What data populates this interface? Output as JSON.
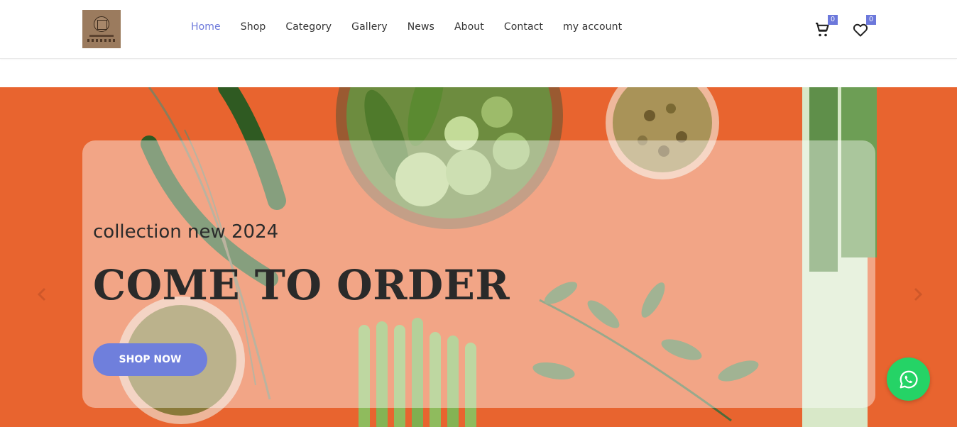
{
  "header": {
    "logo_name": "logo",
    "nav": [
      {
        "label": "Home",
        "active": true
      },
      {
        "label": "Shop",
        "active": false
      },
      {
        "label": "Category",
        "active": false
      },
      {
        "label": "Gallery",
        "active": false
      },
      {
        "label": "News",
        "active": false
      },
      {
        "label": "About",
        "active": false
      },
      {
        "label": "Contact",
        "active": false
      },
      {
        "label": "my account",
        "active": false
      }
    ],
    "cart": {
      "icon": "cart-icon",
      "count": "0"
    },
    "wishlist": {
      "icon": "heart-icon",
      "count": "0"
    }
  },
  "hero": {
    "subtitle": "collection new 2024",
    "headline": "COME TO ORDER",
    "cta_label": "SHOP NOW"
  },
  "floating": {
    "whatsapp_icon": "whatsapp-icon"
  },
  "colors": {
    "accent": "#6c78db",
    "hero_bg": "#e8642f",
    "whatsapp": "#25d366",
    "text_dark": "#2a2a2a"
  }
}
